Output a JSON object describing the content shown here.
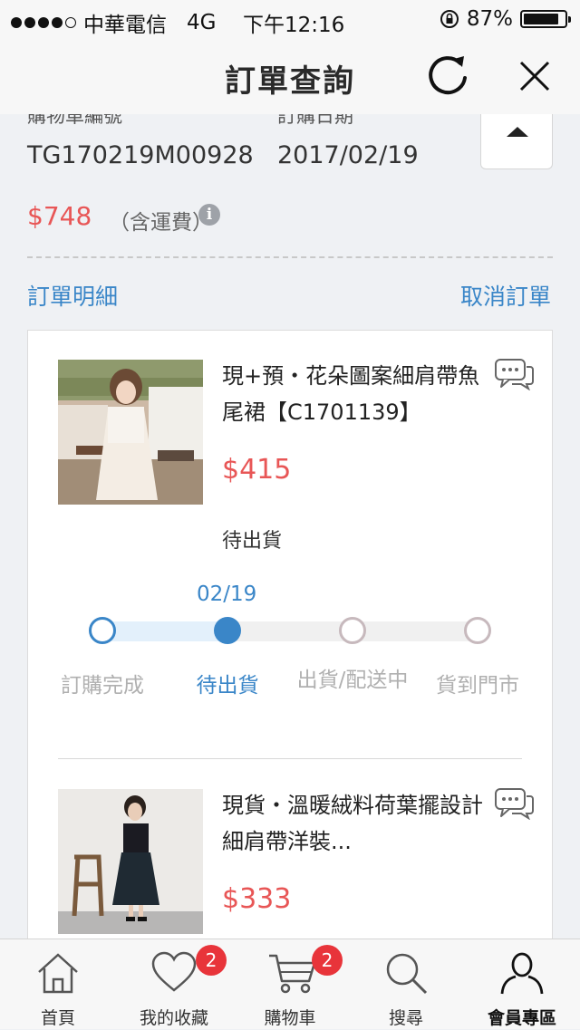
{
  "status_bar": {
    "carrier": "中華電信",
    "network": "4G",
    "time": "下午12:16",
    "battery": "87%",
    "battery_level": 0.87
  },
  "header": {
    "title": "訂單查詢"
  },
  "order": {
    "number_label": "購物車編號",
    "number": "TG170219M00928",
    "date_label": "訂購日期",
    "date": "2017/02/19",
    "total": "$748",
    "shipping_note": "（含運費）",
    "details_link": "訂單明細",
    "cancel_link": "取消訂單"
  },
  "items": [
    {
      "name": "現+預・花朵圖案細肩帶魚尾裙【C1701139】",
      "price": "$415",
      "status": "待出貨",
      "step_date": "02/19",
      "steps": [
        "訂購完成",
        "待出貨",
        "出貨/配送中",
        "貨到門市"
      ],
      "current_step": 2
    },
    {
      "name": "現貨・溫暖絨料荷葉擺設計細肩帶洋裝...",
      "price": "$333"
    }
  ],
  "tabbar": {
    "tabs": [
      {
        "label": "首頁",
        "icon": "home-icon"
      },
      {
        "label": "我的收藏",
        "icon": "heart-icon",
        "badge": "2"
      },
      {
        "label": "購物車",
        "icon": "cart-icon",
        "badge": "2"
      },
      {
        "label": "搜尋",
        "icon": "search-icon"
      },
      {
        "label": "會員專區",
        "icon": "user-icon",
        "active": true
      }
    ]
  },
  "colors": {
    "accent_blue": "#3a86c8",
    "price_red": "#e85656",
    "badge_red": "#e8343a"
  }
}
